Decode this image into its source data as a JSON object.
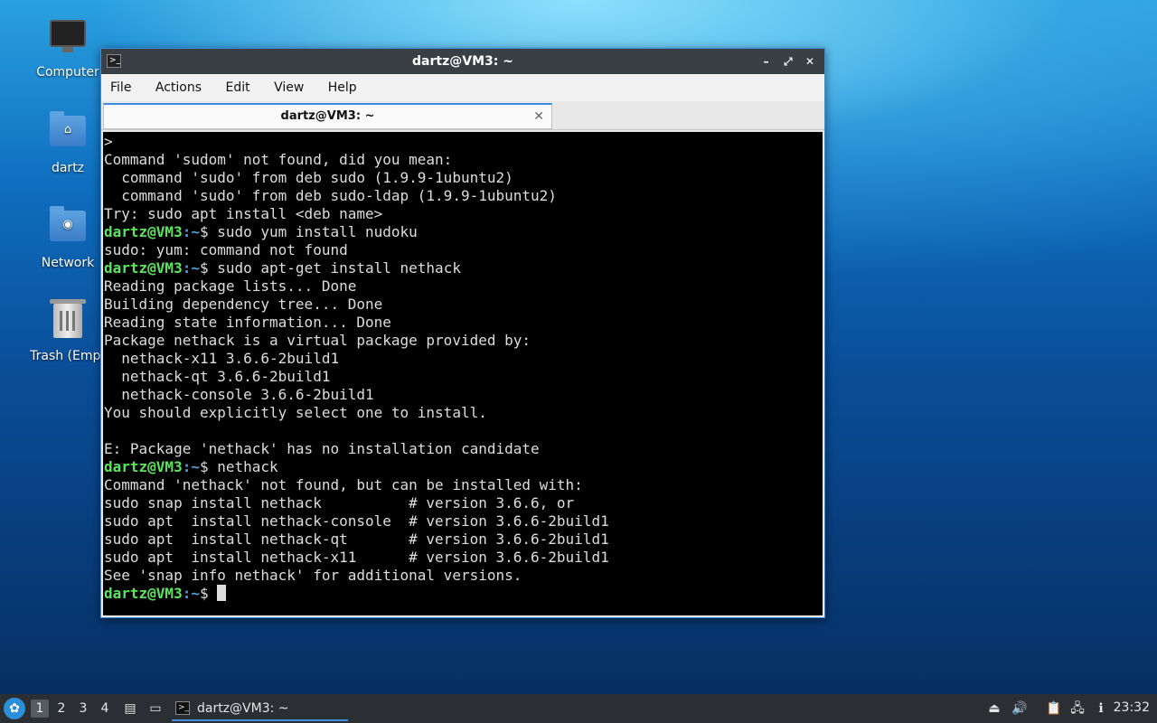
{
  "desktop": {
    "icons": [
      {
        "label": "Computer"
      },
      {
        "label": "dartz"
      },
      {
        "label": "Network"
      },
      {
        "label": "Trash (Empt"
      }
    ]
  },
  "window": {
    "title": "dartz@VM3: ~",
    "controls": {
      "minimize": "–",
      "maximize": "⤢",
      "close": "✕"
    },
    "menu": [
      "File",
      "Actions",
      "Edit",
      "View",
      "Help"
    ],
    "tab": {
      "label": "dartz@VM3: ~",
      "close": "✕"
    }
  },
  "terminal": {
    "user": "dartz@VM3",
    "path": ":~",
    "lines": [
      {
        "type": "text",
        "text": ">"
      },
      {
        "type": "text",
        "text": "Command 'sudom' not found, did you mean:"
      },
      {
        "type": "text",
        "text": "  command 'sudo' from deb sudo (1.9.9-1ubuntu2)"
      },
      {
        "type": "text",
        "text": "  command 'sudo' from deb sudo-ldap (1.9.9-1ubuntu2)"
      },
      {
        "type": "text",
        "text": "Try: sudo apt install <deb name>"
      },
      {
        "type": "prompt",
        "cmd": "$ sudo yum install nudoku"
      },
      {
        "type": "text",
        "text": "sudo: yum: command not found"
      },
      {
        "type": "prompt",
        "cmd": "$ sudo apt-get install nethack"
      },
      {
        "type": "text",
        "text": "Reading package lists... Done"
      },
      {
        "type": "text",
        "text": "Building dependency tree... Done"
      },
      {
        "type": "text",
        "text": "Reading state information... Done"
      },
      {
        "type": "text",
        "text": "Package nethack is a virtual package provided by:"
      },
      {
        "type": "text",
        "text": "  nethack-x11 3.6.6-2build1"
      },
      {
        "type": "text",
        "text": "  nethack-qt 3.6.6-2build1"
      },
      {
        "type": "text",
        "text": "  nethack-console 3.6.6-2build1"
      },
      {
        "type": "text",
        "text": "You should explicitly select one to install."
      },
      {
        "type": "text",
        "text": ""
      },
      {
        "type": "text",
        "text": "E: Package 'nethack' has no installation candidate"
      },
      {
        "type": "prompt",
        "cmd": "$ nethack"
      },
      {
        "type": "text",
        "text": "Command 'nethack' not found, but can be installed with:"
      },
      {
        "type": "text",
        "text": "sudo snap install nethack          # version 3.6.6, or"
      },
      {
        "type": "text",
        "text": "sudo apt  install nethack-console  # version 3.6.6-2build1"
      },
      {
        "type": "text",
        "text": "sudo apt  install nethack-qt       # version 3.6.6-2build1"
      },
      {
        "type": "text",
        "text": "sudo apt  install nethack-x11      # version 3.6.6-2build1"
      },
      {
        "type": "text",
        "text": "See 'snap info nethack' for additional versions."
      },
      {
        "type": "prompt",
        "cmd": "$ ",
        "cursor": true
      }
    ]
  },
  "taskbar": {
    "workspaces": [
      "1",
      "2",
      "3",
      "4"
    ],
    "active_workspace": 0,
    "app_label": "dartz@VM3: ~",
    "clock": "23:32"
  }
}
